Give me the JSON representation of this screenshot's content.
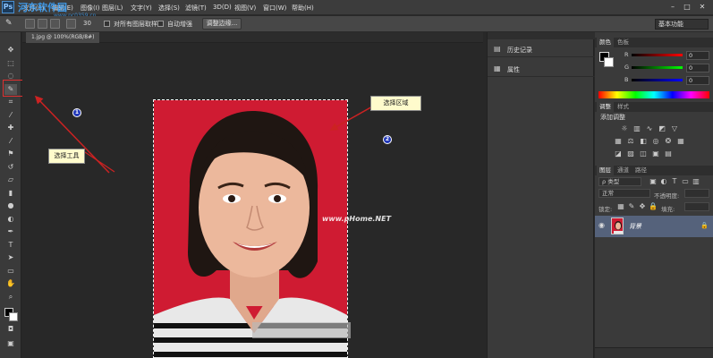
{
  "menubar": {
    "logo": "Ps",
    "watermark": "河东软件园",
    "watermark_url": "www.pc0359.cn",
    "items": [
      "文件(F)",
      "编辑(E)",
      "图像(I)",
      "图层(L)",
      "文字(Y)",
      "选择(S)",
      "滤镜(T)",
      "3D(D)",
      "视图(V)",
      "窗口(W)",
      "帮助(H)"
    ],
    "window_buttons": [
      "–",
      "□",
      "✕"
    ]
  },
  "options_bar": {
    "tool_icon": "quick-selection-icon",
    "brush_size": "30",
    "sample_all_layers": "对所有图层取样",
    "auto_enhance": "自动增强",
    "refine_edge_button": "调整边缘...",
    "workspace": "基本功能"
  },
  "document": {
    "tab_label": "1.jpg @ 100%(RGB/8#)",
    "watermark": "www.pHome.NET"
  },
  "annotations": {
    "callout_tool": "选择工具",
    "callout_region": "选择区域",
    "badge1": "1",
    "badge2": "2",
    "accent": "#cc2222"
  },
  "mid_panels": {
    "history": "历史记录",
    "properties": "属性"
  },
  "color_panel": {
    "tabs": [
      "颜色",
      "色板"
    ],
    "r_label": "R",
    "g_label": "G",
    "b_label": "B",
    "r_value": "0",
    "g_value": "0",
    "b_value": "0"
  },
  "adjustments_panel": {
    "tabs": [
      "调整",
      "样式"
    ],
    "title": "添加调整"
  },
  "layers_panel": {
    "tabs": [
      "图层",
      "通道",
      "路径"
    ],
    "kind": "ρ 类型",
    "blend_mode": "正常",
    "opacity_label": "不透明度:",
    "lock_label": "锁定:",
    "fill_label": "填充:",
    "layer_name": "背景"
  },
  "colors": {
    "photo_bg": "#cf1b32",
    "selected_layer": "#55627b",
    "badge": "#2238b8",
    "callout": "#fffbcc"
  }
}
